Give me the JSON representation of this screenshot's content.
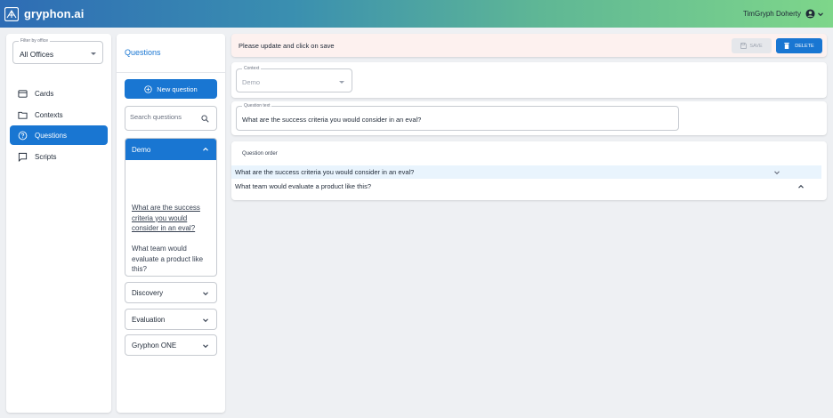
{
  "app": {
    "name": "gryphon.ai"
  },
  "user": {
    "name": "TimGryph Doherty"
  },
  "sidebar": {
    "office_filter": {
      "label": "Filter by office",
      "value": "All Offices"
    },
    "items": [
      {
        "label": "Cards",
        "icon": "card-icon"
      },
      {
        "label": "Contexts",
        "icon": "folder-icon"
      },
      {
        "label": "Questions",
        "icon": "question-circle-icon",
        "active": true
      },
      {
        "label": "Scripts",
        "icon": "chat-bubble-icon"
      }
    ]
  },
  "questions_panel": {
    "title": "Questions",
    "new_button": "New question",
    "search_placeholder": "Search questions",
    "groups": [
      {
        "name": "Demo",
        "expanded": true,
        "questions": [
          "What are the success criteria you would consider in an eval?",
          "What team would evaluate a product like this?"
        ]
      },
      {
        "name": "Discovery",
        "expanded": false
      },
      {
        "name": "Evaluation",
        "expanded": false
      },
      {
        "name": "Gryphon ONE",
        "expanded": false
      }
    ]
  },
  "editor": {
    "banner": "Please update and click on save",
    "save_label": "SAVE",
    "delete_label": "DELETE",
    "context": {
      "label": "Context",
      "value": "Demo"
    },
    "question_text": {
      "label": "Question text",
      "value": "What are the success criteria you would consider in an eval?"
    },
    "order": {
      "title": "Question order",
      "items": [
        "What are the success criteria you would consider in an eval?",
        "What team would evaluate a product like this?"
      ]
    }
  },
  "colors": {
    "primary": "#1976d2",
    "banner_bg": "#fdf1ef",
    "highlight_row": "#e9f4fd",
    "background": "#eef0f3"
  }
}
